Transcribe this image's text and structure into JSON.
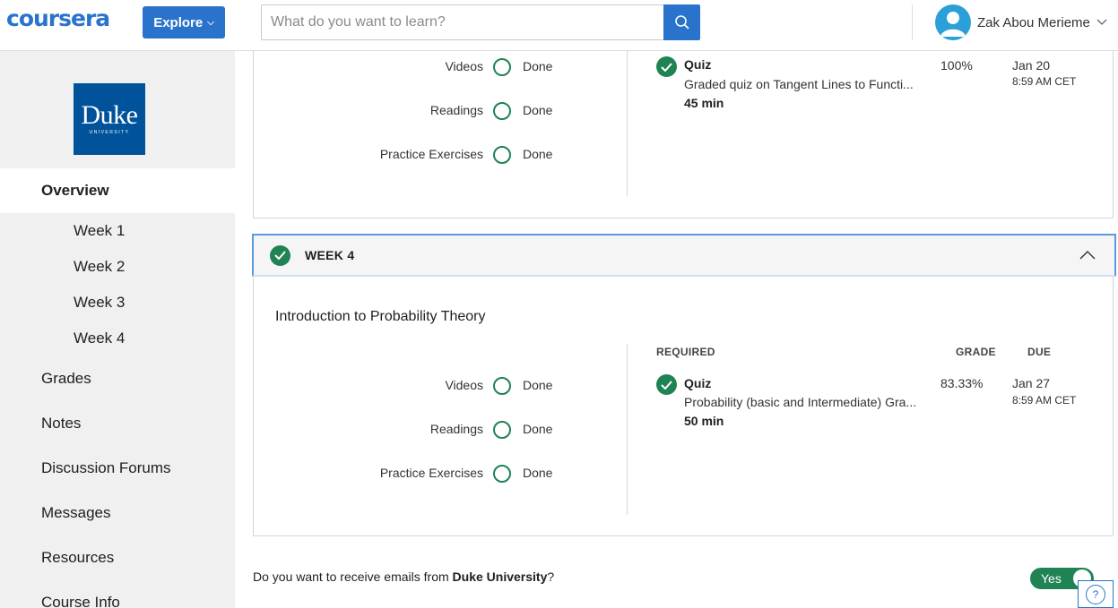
{
  "header": {
    "logo": "coursera",
    "explore_label": "Explore",
    "search_placeholder": "What do you want to learn?",
    "user_name": "Zak Abou Merieme"
  },
  "sidebar": {
    "logo_word": "Duke",
    "logo_sub": "UNIVERSITY",
    "overview": "Overview",
    "weeks": [
      "Week 1",
      "Week 2",
      "Week 3",
      "Week 4"
    ],
    "items": [
      "Grades",
      "Notes",
      "Discussion Forums",
      "Messages",
      "Resources",
      "Course Info"
    ]
  },
  "week3_partial": {
    "progress": [
      {
        "label": "Videos",
        "status": "Done"
      },
      {
        "label": "Readings",
        "status": "Done"
      },
      {
        "label": "Practice Exercises",
        "status": "Done"
      }
    ],
    "item": {
      "type": "Quiz",
      "name": "Graded quiz on Tangent Lines to Functi...",
      "duration": "45 min",
      "grade": "100%",
      "due_date": "Jan 20",
      "due_time": "8:59 AM CET"
    }
  },
  "week4": {
    "title": "WEEK 4",
    "module_title": "Introduction to Probability Theory",
    "columns": {
      "required": "REQUIRED",
      "grade": "GRADE",
      "due": "DUE"
    },
    "progress": [
      {
        "label": "Videos",
        "status": "Done"
      },
      {
        "label": "Readings",
        "status": "Done"
      },
      {
        "label": "Practice Exercises",
        "status": "Done"
      }
    ],
    "item": {
      "type": "Quiz",
      "name": "Probability (basic and Intermediate) Gra...",
      "duration": "50 min",
      "grade": "83.33%",
      "due_date": "Jan 27",
      "due_time": "8:59 AM CET"
    }
  },
  "email_pref": {
    "question_prefix": "Do you want to receive emails from ",
    "university": "Duke University",
    "question_suffix": "?",
    "toggle_label": "Yes"
  },
  "colors": {
    "brand_blue": "#2a73cc",
    "success_green": "#1f8354",
    "duke_blue": "#00539b"
  }
}
